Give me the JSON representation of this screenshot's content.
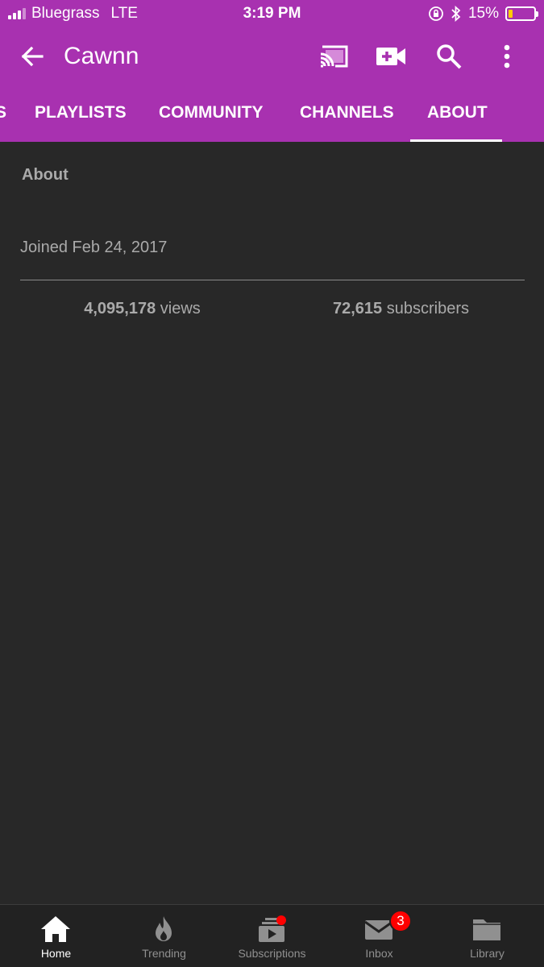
{
  "status_bar": {
    "carrier": "Bluegrass",
    "network": "LTE",
    "time": "3:19 PM",
    "battery_percent": "15%",
    "battery_level": 0.15
  },
  "app_bar": {
    "title": "Cawnn",
    "icons": [
      "back-arrow-icon",
      "cast-icon",
      "add-video-icon",
      "search-icon",
      "more-vert-icon"
    ]
  },
  "tabs": [
    {
      "label": "S",
      "active": false
    },
    {
      "label": "PLAYLISTS",
      "active": false
    },
    {
      "label": "COMMUNITY",
      "active": false
    },
    {
      "label": "CHANNELS",
      "active": false
    },
    {
      "label": "ABOUT",
      "active": true
    }
  ],
  "about": {
    "heading": "About",
    "joined": "Joined Feb 24, 2017",
    "views_count": "4,095,178",
    "views_label": " views",
    "subscribers_count": "72,615",
    "subscribers_label": " subscribers"
  },
  "bottom_nav": [
    {
      "label": "Home",
      "icon": "home-icon",
      "active": true
    },
    {
      "label": "Trending",
      "icon": "trending-flame-icon",
      "active": false
    },
    {
      "label": "Subscriptions",
      "icon": "subscriptions-icon",
      "active": false,
      "dot": true
    },
    {
      "label": "Inbox",
      "icon": "inbox-mail-icon",
      "active": false,
      "badge": "3"
    },
    {
      "label": "Library",
      "icon": "library-folder-icon",
      "active": false
    }
  ],
  "colors": {
    "brand": "#a831b0",
    "background": "#282828",
    "nav_background": "#222222",
    "badge": "#ff0000",
    "battery": "#ffcc00"
  }
}
